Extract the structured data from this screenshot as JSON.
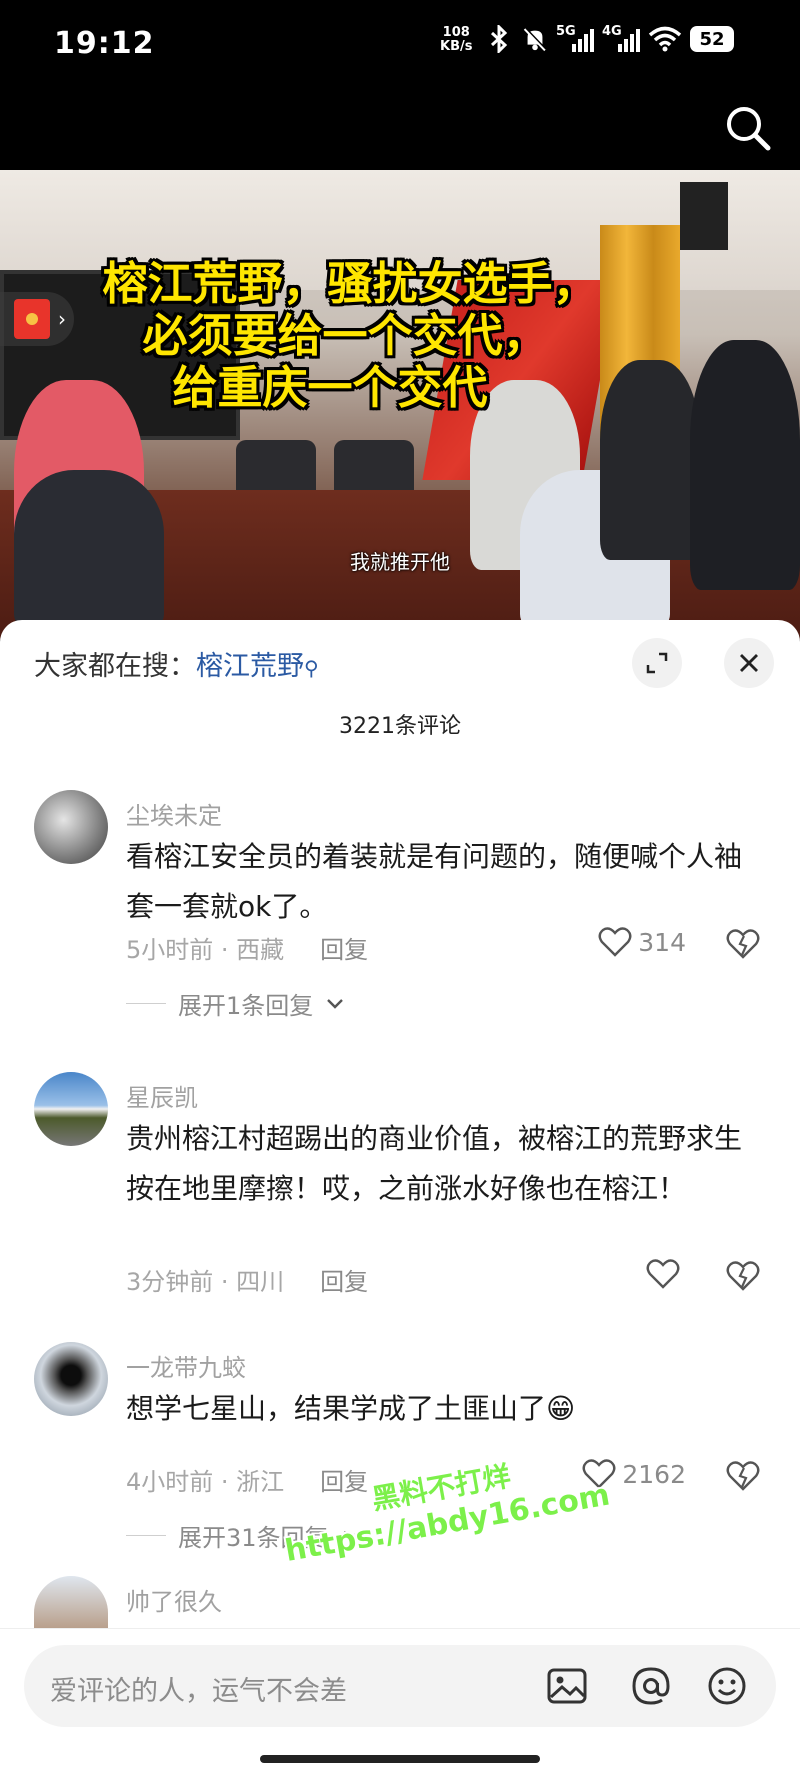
{
  "status_bar": {
    "time": "19:12",
    "net_speed_value": "108",
    "net_speed_unit": "KB/s",
    "signal_1_label": "5G",
    "signal_2_label": "4G",
    "battery": "52"
  },
  "video": {
    "title_lines": [
      "榕江荒野，骚扰女选手，",
      "必须要给一个交代，",
      "给重庆一个交代"
    ],
    "caption": "我就推开他"
  },
  "sheet": {
    "hot_search_label": "大家都在搜：",
    "hot_search_keyword": "榕江荒野",
    "comment_count": "3221条评论"
  },
  "comments": [
    {
      "name": "尘埃未定",
      "text": "看榕江安全员的着装就是有问题的，随便喊个人袖套一套就ok了。",
      "time": "5小时前",
      "location": "西藏",
      "reply": "回复",
      "likes": "314",
      "expand": "展开1条回复"
    },
    {
      "name": "星辰凯",
      "text": "贵州榕江村超踢出的商业价值，被榕江的荒野求生按在地里摩擦！哎，之前涨水好像也在榕江！",
      "time": "3分钟前",
      "location": "四川",
      "reply": "回复",
      "likes": ""
    },
    {
      "name": "一龙带九蛟",
      "text": "想学七星山，结果学成了土匪山了",
      "emoji": "😁",
      "time": "4小时前",
      "location": "浙江",
      "reply": "回复",
      "likes": "2162",
      "expand": "展开31条回复"
    },
    {
      "name": "帅了很久"
    }
  ],
  "watermark": {
    "line1": "黑料不打烊",
    "line2": "https://abdy16.com"
  },
  "input": {
    "placeholder": "爱评论的人，运气不会差"
  },
  "icons": [
    "search-icon",
    "red-packet-icon",
    "expand-icon",
    "close-icon",
    "heart-icon",
    "dislike-icon",
    "chevron-down-icon",
    "image-icon",
    "at-icon",
    "emoji-icon"
  ]
}
